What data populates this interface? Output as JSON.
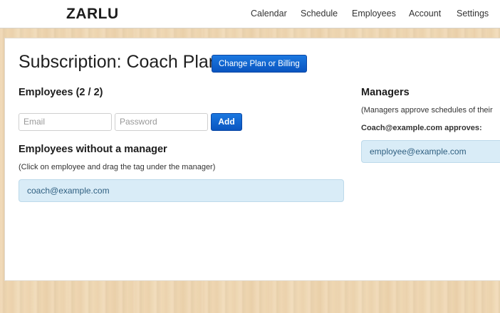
{
  "app": {
    "brand": "ZARLU"
  },
  "nav": {
    "items": [
      "Calendar",
      "Schedule",
      "Employees",
      "Account",
      "Settings"
    ]
  },
  "page": {
    "title": "Subscription: Coach Plan",
    "change_plan_label": "Change Plan or Billing"
  },
  "employees": {
    "heading": "Employees (2 / 2)",
    "email_placeholder": "Email",
    "password_placeholder": "Password",
    "add_label": "Add"
  },
  "unassigned": {
    "heading": "Employees without a manager",
    "hint": "(Click on employee and drag the tag under the manager)",
    "tags": [
      "coach@example.com"
    ]
  },
  "managers": {
    "heading": "Managers",
    "hint": "(Managers approve schedules of their",
    "list": [
      {
        "label": "Coach@example.com approves:",
        "tags": [
          "employee@example.com"
        ]
      }
    ]
  },
  "colors": {
    "primary_button": "#0a55c0",
    "tag_background": "#d9ecf7",
    "tag_text": "#2f5f80"
  }
}
